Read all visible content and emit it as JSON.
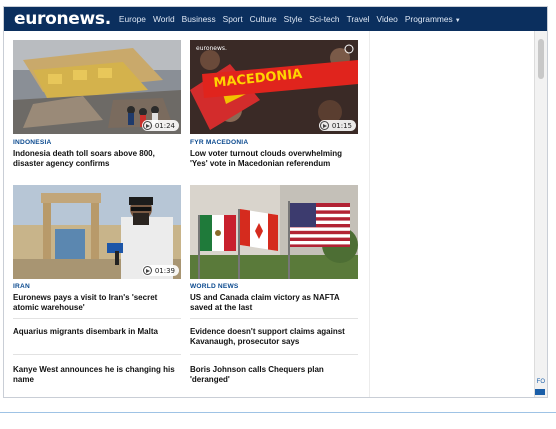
{
  "nav": {
    "logo": "euronews.",
    "items": [
      "Europe",
      "World",
      "Business",
      "Sport",
      "Culture",
      "Style",
      "Sci-tech",
      "Travel",
      "Video",
      "Programmes"
    ]
  },
  "articles": [
    {
      "kicker": "INDONESIA",
      "headline": "Indonesia death toll soars above 800, disaster agency confirms",
      "duration": "01:24"
    },
    {
      "kicker": "FYR MACEDONIA",
      "headline": "Low voter turnout clouds overwhelming 'Yes' vote in Macedonian referendum",
      "duration": "01:15"
    },
    {
      "kicker": "IRAN",
      "headline": "Euronews pays a visit to Iran's 'secret atomic warehouse'",
      "duration": "01:39"
    },
    {
      "kicker": "WORLD NEWS",
      "headline": "US and Canada claim victory as NAFTA saved at the last"
    }
  ],
  "text_items": {
    "left": [
      "Aquarius migrants disembark in Malta",
      "Kanye West announces he is changing his name"
    ],
    "right": [
      "Evidence doesn't support claims against Kavanaugh, prosecutor says",
      "Boris Johnson calls Chequers plan 'deranged'"
    ]
  },
  "thumb_texts": {
    "watermark": "euronews.",
    "banner": "MACEDONIA"
  },
  "corner_text": "FO"
}
